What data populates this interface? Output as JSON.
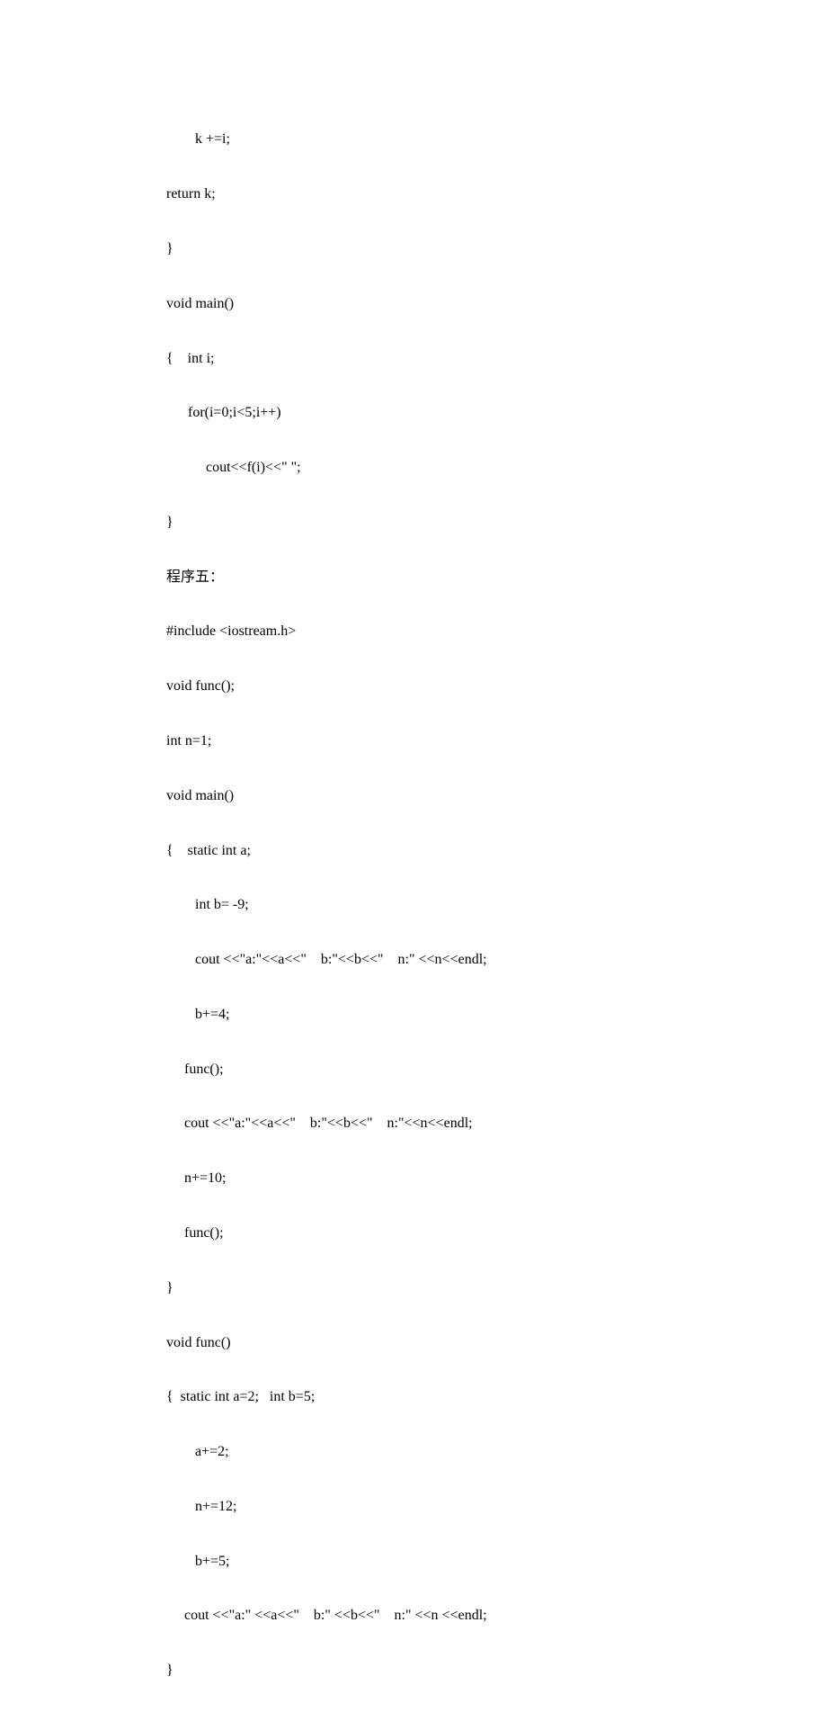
{
  "lines": [
    "        k +=i;",
    "return k;",
    "}",
    "void main()",
    "{    int i;",
    "      for(i=0;i<5;i++)",
    "           cout<<f(i)<<\" \";",
    "}",
    "程序五：",
    "#include <iostream.h>",
    "void func();",
    "int n=1;",
    "void main()",
    "{    static int a;",
    "        int b= -9;",
    "        cout <<\"a:\"<<a<<\"    b:\"<<b<<\"    n:\" <<n<<endl;",
    "        b+=4;",
    "     func();",
    "     cout <<\"a:\"<<a<<\"    b:\"<<b<<\"    n:\"<<n<<endl;",
    "     n+=10;",
    "     func();",
    "}",
    "void func()",
    "{  static int a=2;   int b=5;",
    "        a+=2;",
    "        n+=12;",
    "        b+=5;",
    "     cout <<\"a:\" <<a<<\"    b:\" <<b<<\"    n:\" <<n <<endl;",
    "}"
  ]
}
